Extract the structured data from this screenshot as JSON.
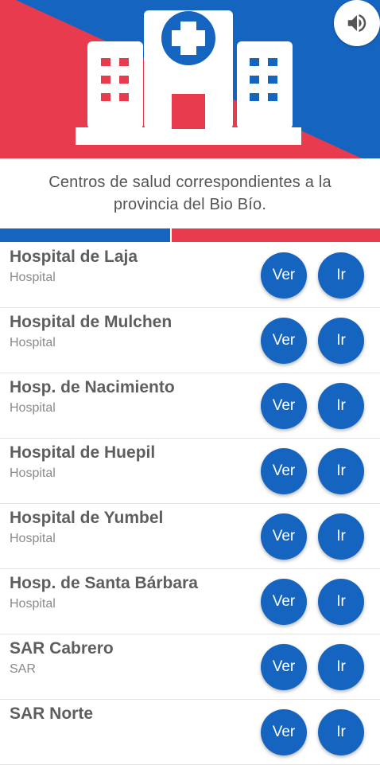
{
  "header": {
    "icon": "hospital-building-icon",
    "colors": {
      "blue": "#1565c0",
      "red": "#e83b4e",
      "white": "#ffffff"
    },
    "sound_icon": "speaker-icon"
  },
  "subtitle": "Centros de salud correspondientes a la provincia del Bio Bío.",
  "list": {
    "items": [
      {
        "name": "Hospital de Laja",
        "type": "Hospital",
        "ver_label": "Ver",
        "ir_label": "Ir"
      },
      {
        "name": "Hospital de Mulchen",
        "type": "Hospital",
        "ver_label": "Ver",
        "ir_label": "Ir"
      },
      {
        "name": "Hosp. de Nacimiento",
        "type": "Hospital",
        "ver_label": "Ver",
        "ir_label": "Ir"
      },
      {
        "name": "Hospital de Huepil",
        "type": "Hospital",
        "ver_label": "Ver",
        "ir_label": "Ir"
      },
      {
        "name": "Hospital de Yumbel",
        "type": "Hospital",
        "ver_label": "Ver",
        "ir_label": "Ir"
      },
      {
        "name": "Hosp. de Santa Bárbara",
        "type": "Hospital",
        "ver_label": "Ver",
        "ir_label": "Ir"
      },
      {
        "name": "SAR Cabrero",
        "type": "SAR",
        "ver_label": "Ver",
        "ir_label": "Ir"
      },
      {
        "name": "SAR Norte",
        "type": "",
        "ver_label": "Ver",
        "ir_label": "Ir"
      }
    ]
  }
}
